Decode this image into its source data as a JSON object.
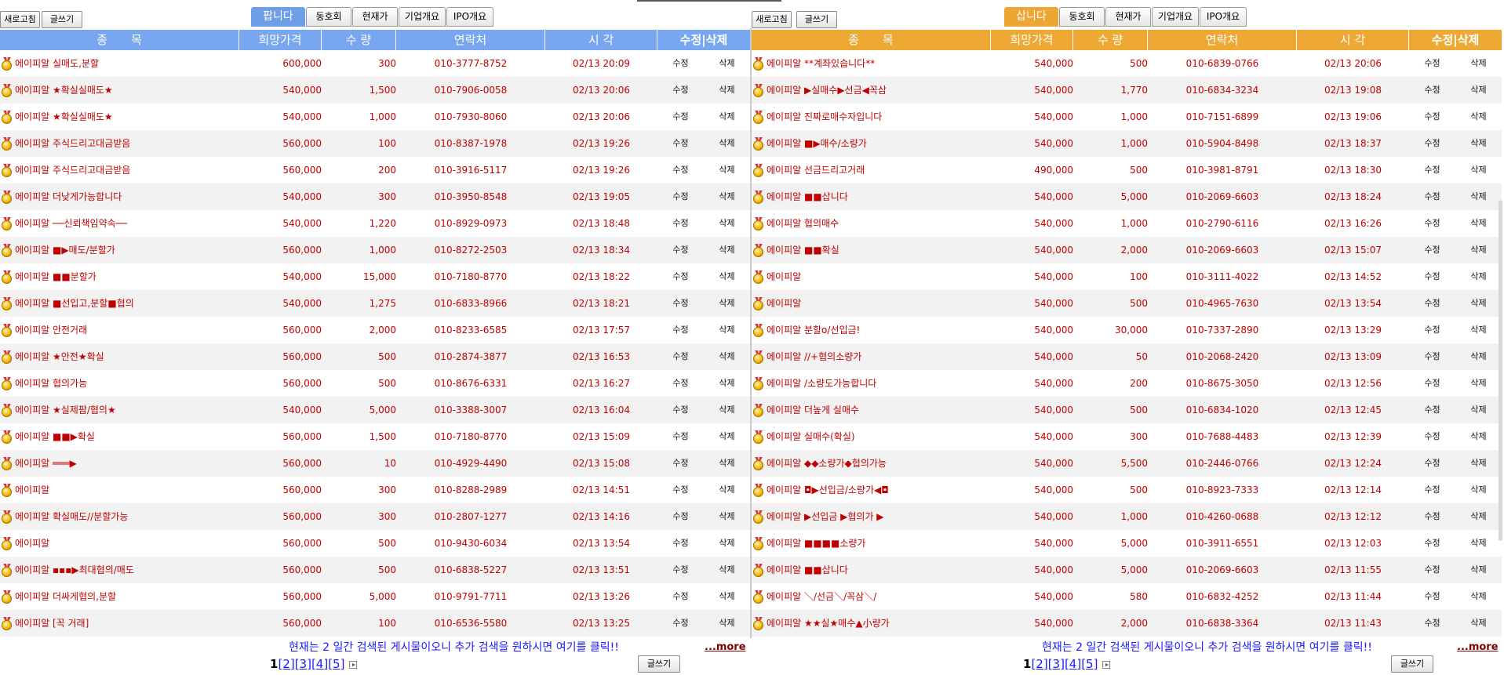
{
  "toolbar": {
    "refresh_label": "새로고침",
    "write_label": "글쓰기"
  },
  "tabs": {
    "sell_active": "팝니다",
    "buy_active": "삽니다",
    "others": [
      "동호회",
      "현재가",
      "기업개요",
      "IPO개요"
    ]
  },
  "headers": [
    "종　　목",
    "희망가격",
    "수 량",
    "연락처",
    "시 각",
    "수정|삭제"
  ],
  "row_actions": {
    "edit": "수정",
    "delete": "삭제"
  },
  "sell": {
    "rows": [
      {
        "name": "에이피알 실매도,분할",
        "price": "600,000",
        "qty": "300",
        "phone": "010-3777-8752",
        "time": "02/13 20:09"
      },
      {
        "name": "에이피알 ★확실실매도★",
        "price": "540,000",
        "qty": "1,500",
        "phone": "010-7906-0058",
        "time": "02/13 20:06"
      },
      {
        "name": "에이피알 ★확실실매도★",
        "price": "540,000",
        "qty": "1,000",
        "phone": "010-7930-8060",
        "time": "02/13 20:06"
      },
      {
        "name": "에이피알 주식드리고대금받음",
        "price": "560,000",
        "qty": "100",
        "phone": "010-8387-1978",
        "time": "02/13 19:26"
      },
      {
        "name": "에이피알 주식드리고대금받음",
        "price": "560,000",
        "qty": "200",
        "phone": "010-3916-5117",
        "time": "02/13 19:26"
      },
      {
        "name": "에이피알 더낮게가능합니다",
        "price": "540,000",
        "qty": "300",
        "phone": "010-3950-8548",
        "time": "02/13 19:05"
      },
      {
        "name": "에이피알 ──신뢰책임약속──",
        "price": "540,000",
        "qty": "1,220",
        "phone": "010-8929-0973",
        "time": "02/13 18:48"
      },
      {
        "name": "에이피알 ■▶매도/분할가",
        "price": "560,000",
        "qty": "1,000",
        "phone": "010-8272-2503",
        "time": "02/13 18:34"
      },
      {
        "name": "에이피알 ■■분할가",
        "price": "540,000",
        "qty": "15,000",
        "phone": "010-7180-8770",
        "time": "02/13 18:22"
      },
      {
        "name": "에이피알 ■선입고,분할■협의",
        "price": "540,000",
        "qty": "1,275",
        "phone": "010-6833-8966",
        "time": "02/13 18:21"
      },
      {
        "name": "에이피알 안전거래",
        "price": "560,000",
        "qty": "2,000",
        "phone": "010-8233-6585",
        "time": "02/13 17:57"
      },
      {
        "name": "에이피알 ★안전★확실",
        "price": "560,000",
        "qty": "500",
        "phone": "010-2874-3877",
        "time": "02/13 16:53"
      },
      {
        "name": "에이피알 협의가능",
        "price": "560,000",
        "qty": "500",
        "phone": "010-8676-6331",
        "time": "02/13 16:27"
      },
      {
        "name": "에이피알 ★실제팜/협의★",
        "price": "540,000",
        "qty": "5,000",
        "phone": "010-3388-3007",
        "time": "02/13 16:04"
      },
      {
        "name": "에이피알 ■■▶확실",
        "price": "560,000",
        "qty": "1,500",
        "phone": "010-7180-8770",
        "time": "02/13 15:09"
      },
      {
        "name": "에이피알 ═══▶",
        "price": "560,000",
        "qty": "10",
        "phone": "010-4929-4490",
        "time": "02/13 15:08"
      },
      {
        "name": "에이피알",
        "price": "560,000",
        "qty": "300",
        "phone": "010-8288-2989",
        "time": "02/13 14:51"
      },
      {
        "name": "에이피알 확실매도//분할가능",
        "price": "560,000",
        "qty": "300",
        "phone": "010-2807-1277",
        "time": "02/13 14:16"
      },
      {
        "name": "에이피알",
        "price": "560,000",
        "qty": "500",
        "phone": "010-9430-6034",
        "time": "02/13 13:54"
      },
      {
        "name": "에이피알 ▪▪▪▶최대협의/매도",
        "price": "560,000",
        "qty": "500",
        "phone": "010-6838-5227",
        "time": "02/13 13:51"
      },
      {
        "name": "에이피알 더싸게협의,분할",
        "price": "560,000",
        "qty": "5,000",
        "phone": "010-9791-7711",
        "time": "02/13 13:26"
      },
      {
        "name": "에이피알 [꼭 거래]",
        "price": "560,000",
        "qty": "100",
        "phone": "010-6536-5580",
        "time": "02/13 13:25"
      }
    ]
  },
  "buy": {
    "rows": [
      {
        "name": "에이피알 **계좌있습니다**",
        "price": "540,000",
        "qty": "500",
        "phone": "010-6839-0766",
        "time": "02/13 20:06"
      },
      {
        "name": "에이피알 ▶실매수▶선금◀꼭삼",
        "price": "540,000",
        "qty": "1,770",
        "phone": "010-6834-3234",
        "time": "02/13 19:08"
      },
      {
        "name": "에이피알 진짜로매수자입니다",
        "price": "540,000",
        "qty": "1,000",
        "phone": "010-7151-6899",
        "time": "02/13 19:06"
      },
      {
        "name": "에이피알 ■▶매수/소량가",
        "price": "540,000",
        "qty": "1,000",
        "phone": "010-5904-8498",
        "time": "02/13 18:37"
      },
      {
        "name": "에이피알 선금드리고거래",
        "price": "490,000",
        "qty": "500",
        "phone": "010-3981-8791",
        "time": "02/13 18:30"
      },
      {
        "name": "에이피알 ■■삽니다",
        "price": "540,000",
        "qty": "5,000",
        "phone": "010-2069-6603",
        "time": "02/13 18:24"
      },
      {
        "name": "에이피알 협의매수",
        "price": "540,000",
        "qty": "1,000",
        "phone": "010-2790-6116",
        "time": "02/13 16:26"
      },
      {
        "name": "에이피알 ■■확실",
        "price": "540,000",
        "qty": "2,000",
        "phone": "010-2069-6603",
        "time": "02/13 15:07"
      },
      {
        "name": "에이피알",
        "price": "540,000",
        "qty": "100",
        "phone": "010-3111-4022",
        "time": "02/13 14:52"
      },
      {
        "name": "에이피알",
        "price": "540,000",
        "qty": "500",
        "phone": "010-4965-7630",
        "time": "02/13 13:54"
      },
      {
        "name": "에이피알 분할o/선입금!",
        "price": "540,000",
        "qty": "30,000",
        "phone": "010-7337-2890",
        "time": "02/13 13:29"
      },
      {
        "name": "에이피알 //+협의소량가",
        "price": "540,000",
        "qty": "50",
        "phone": "010-2068-2420",
        "time": "02/13 13:09"
      },
      {
        "name": "에이피알 /소량도가능합니다",
        "price": "540,000",
        "qty": "200",
        "phone": "010-8675-3050",
        "time": "02/13 12:56"
      },
      {
        "name": "에이피알 더높게 실매수",
        "price": "540,000",
        "qty": "500",
        "phone": "010-6834-1020",
        "time": "02/13 12:45"
      },
      {
        "name": "에이피알 실매수(확실)",
        "price": "540,000",
        "qty": "300",
        "phone": "010-7688-4483",
        "time": "02/13 12:39"
      },
      {
        "name": "에이피알 ◆◆소량가◆협의가능",
        "price": "540,000",
        "qty": "5,500",
        "phone": "010-2446-0766",
        "time": "02/13 12:24"
      },
      {
        "name": "에이피알 ◘▶선입금/소량가◀◘",
        "price": "540,000",
        "qty": "500",
        "phone": "010-8923-7333",
        "time": "02/13 12:14"
      },
      {
        "name": "에이피알 ▶선입금 ▶협의가 ▶",
        "price": "540,000",
        "qty": "1,000",
        "phone": "010-4260-0688",
        "time": "02/13 12:12"
      },
      {
        "name": "에이피알 ■■■■소량가",
        "price": "540,000",
        "qty": "5,000",
        "phone": "010-3911-6551",
        "time": "02/13 12:03"
      },
      {
        "name": "에이피알 ■■삽니다",
        "price": "540,000",
        "qty": "5,000",
        "phone": "010-2069-6603",
        "time": "02/13 11:55"
      },
      {
        "name": "에이피알 ＼/선금＼/꼭삼＼/",
        "price": "540,000",
        "qty": "580",
        "phone": "010-6832-4252",
        "time": "02/13 11:44"
      },
      {
        "name": "에이피알 ★★실★매수▲小량가",
        "price": "540,000",
        "qty": "2,000",
        "phone": "010-6838-3364",
        "time": "02/13 11:43"
      }
    ]
  },
  "footer": {
    "notice": "현재는 2 일간 검색된 게시물이오니 추가 검색을 원하시면 여기를 클릭!!",
    "more": "...more",
    "current_page": "1",
    "pages": [
      "[2]",
      "[3]",
      "[4]",
      "[5]"
    ]
  },
  "colors": {
    "sell_header": "#78a6ef",
    "buy_header": "#eda934",
    "text_red": "#c00000",
    "link_blue": "#1a1aff"
  }
}
